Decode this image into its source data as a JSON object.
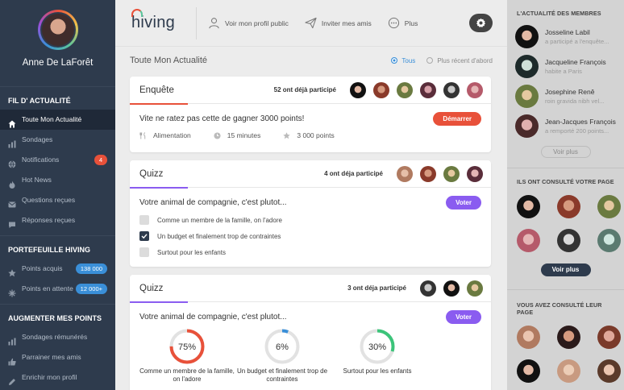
{
  "user": {
    "name": "Anne De LaForêt"
  },
  "sidebar": {
    "sections": [
      {
        "title": "FIL D' ACTUALITÉ",
        "items": [
          {
            "label": "Toute Mon Actualité",
            "icon": "home-icon",
            "active": true
          },
          {
            "label": "Sondages",
            "icon": "bar-chart-icon"
          },
          {
            "label": "Notifications",
            "icon": "globe-icon",
            "badge": "4"
          },
          {
            "label": "Hot News",
            "icon": "flame-icon"
          },
          {
            "label": "Questions reçues",
            "icon": "inbox-icon"
          },
          {
            "label": "Réponses reçues",
            "icon": "chat-icon"
          }
        ]
      },
      {
        "title": "PORTEFEUILLE HIVING",
        "items": [
          {
            "label": "Points acquis",
            "icon": "star-icon",
            "badge": "138 000"
          },
          {
            "label": "Points en attente",
            "icon": "sparkle-icon",
            "badge": "12 000+"
          }
        ]
      },
      {
        "title": "AUGMENTER MES POINTS",
        "items": [
          {
            "label": "Sondages rémunérés",
            "icon": "bar-chart-icon"
          },
          {
            "label": "Parrainer mes amis",
            "icon": "thumbs-up-icon"
          },
          {
            "label": "Enrichir mon profil",
            "icon": "pencil-icon"
          }
        ]
      }
    ]
  },
  "topbar": {
    "logo": "hiving",
    "public_profile": "Voir mon profil public",
    "invite": "Inviter mes amis",
    "more": "Plus"
  },
  "feed": {
    "title": "Toute Mon Actualité",
    "filter_all": "Tous",
    "filter_recent": "Plus récent d'abord"
  },
  "cards": {
    "survey": {
      "title": "Enquête",
      "participants": "52 ont déjà participé",
      "question": "Vite ne ratez pas cette de gagner 3000 points!",
      "button": "Démarrer",
      "category": "Alimentation",
      "duration": "15 minutes",
      "points": "3 000 points"
    },
    "quiz1": {
      "title": "Quizz",
      "participants": "4 ont déja participé",
      "question": "Votre animal de compagnie, c'est plutot...",
      "button": "Voter",
      "options": [
        {
          "label": "Comme un membre de la famille, on l'adore",
          "checked": false
        },
        {
          "label": "Un budget et finalement trop de contraintes",
          "checked": true
        },
        {
          "label": "Surtout pour les enfants",
          "checked": false
        }
      ]
    },
    "quiz2": {
      "title": "Quizz",
      "participants": "3 ont déja participé",
      "question": "Votre animal de compagnie, c'est plutot...",
      "button": "Voter",
      "results": [
        {
          "percent": 75,
          "label": "75%",
          "caption": "Comme un membre de la famille, on l'adore",
          "color": "#e8513a"
        },
        {
          "percent": 6,
          "label": "6%",
          "caption": "Un budget et finalement trop de contraintes",
          "color": "#3a8fd8"
        },
        {
          "percent": 30,
          "label": "30%",
          "caption": "Surtout pour les enfants",
          "color": "#3cc47a"
        }
      ]
    }
  },
  "right": {
    "activity_title": "L'ACTUALITÉ DES MEMBRES",
    "members": [
      {
        "name": "Josseline Labil",
        "sub": "a participé a l'enquête..."
      },
      {
        "name": "Jacqueline François",
        "sub": "habite a Paris"
      },
      {
        "name": "Josephine Renê",
        "sub": "roin gravida nibh vel..."
      },
      {
        "name": "Jean-Jacques François",
        "sub": "a remporté 200 points..."
      }
    ],
    "see_more": "Voir plus",
    "visitors_title": "ILS ONT CONSULTÉ VOTRE PAGE",
    "see_more_dark": "Voir plus",
    "visited_title": "VOUS AVEZ CONSULTÉ LEUR PAGE"
  },
  "colors": {
    "sidebar": "#2e3b4d",
    "accent_red": "#e8513a",
    "accent_purple": "#8a5cf0",
    "accent_blue": "#3a8fd8",
    "accent_green": "#3cc47a"
  }
}
